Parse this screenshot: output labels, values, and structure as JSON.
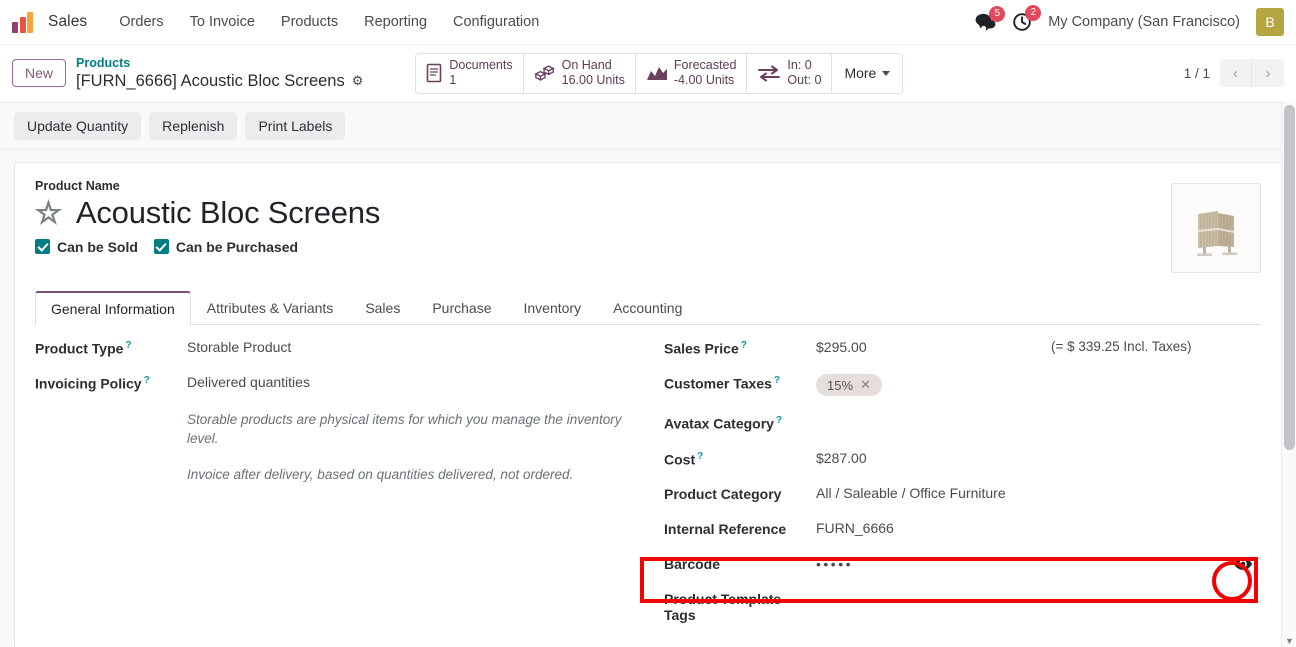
{
  "navbar": {
    "logo_icon": "sales-app-bar-chart-icon",
    "brand": "Sales",
    "menu": [
      {
        "label": "Orders"
      },
      {
        "label": "To Invoice"
      },
      {
        "label": "Products"
      },
      {
        "label": "Reporting"
      },
      {
        "label": "Configuration"
      }
    ],
    "messages_icon": "chat-bubbles-icon",
    "messages_count": "5",
    "activities_icon": "clock-activity-icon",
    "activities_count": "2",
    "company": "My Company (San Francisco)",
    "avatar_initial": "B"
  },
  "control_panel": {
    "new_button": "New",
    "breadcrumb_parent": "Products",
    "breadcrumb_current": "[FURN_6666] Acoustic Bloc Screens",
    "settings_icon": "gear-icon",
    "stat_buttons": [
      {
        "icon": "document-icon",
        "label": "Documents",
        "value": "1"
      },
      {
        "icon": "boxes-icon",
        "label": "On Hand",
        "value": "16.00 Units"
      },
      {
        "icon": "area-chart-icon",
        "label": "Forecasted",
        "value": "-4.00 Units"
      },
      {
        "icon": "exchange-arrows-icon",
        "label": "In: 0",
        "value": "Out: 0"
      }
    ],
    "more_button": "More",
    "pager_text": "1 / 1",
    "prev_icon": "chevron-left-icon",
    "next_icon": "chevron-right-icon"
  },
  "action_bar": {
    "buttons": [
      {
        "label": "Update Quantity"
      },
      {
        "label": "Replenish"
      },
      {
        "label": "Print Labels"
      }
    ]
  },
  "form": {
    "product_name_label": "Product Name",
    "product_name": "Acoustic Bloc Screens",
    "favorite_icon": "star-outline-icon",
    "product_image_alt": "acoustic-bloc-screen-photo",
    "checkboxes": [
      {
        "label": "Can be Sold",
        "checked": true
      },
      {
        "label": "Can be Purchased",
        "checked": true
      }
    ],
    "tabs": [
      {
        "label": "General Information",
        "active": true
      },
      {
        "label": "Attributes & Variants",
        "active": false
      },
      {
        "label": "Sales",
        "active": false
      },
      {
        "label": "Purchase",
        "active": false
      },
      {
        "label": "Inventory",
        "active": false
      },
      {
        "label": "Accounting",
        "active": false
      }
    ],
    "left_fields": [
      {
        "label": "Product Type",
        "help": true,
        "value": "Storable Product"
      },
      {
        "label": "Invoicing Policy",
        "help": true,
        "value": "Delivered quantities"
      }
    ],
    "help_texts": [
      "Storable products are physical items for which you manage the inventory level.",
      "Invoice after delivery, based on quantities delivered, not ordered."
    ],
    "right_fields": {
      "sales_price_label": "Sales Price",
      "sales_price_value": "$295.00",
      "sales_price_incl": "(= $ 339.25 Incl. Taxes)",
      "customer_taxes_label": "Customer Taxes",
      "customer_tax_tag": "15%",
      "tax_remove_icon": "close-x-icon",
      "avatax_label": "Avatax Category",
      "avatax_value": "",
      "cost_label": "Cost",
      "cost_value": "$287.00",
      "product_category_label": "Product Category",
      "product_category_value": "All / Saleable / Office Furniture",
      "internal_reference_label": "Internal Reference",
      "internal_reference_value": "FURN_6666",
      "barcode_label": "Barcode",
      "barcode_value": "•••••",
      "barcode_eye_icon": "eye-icon",
      "product_tags_label": "Product Template Tags"
    }
  },
  "annotations": {
    "highlight_color": "#f50000",
    "rect_target": "barcode-field-row",
    "circle_target": "barcode-eye-icon"
  }
}
